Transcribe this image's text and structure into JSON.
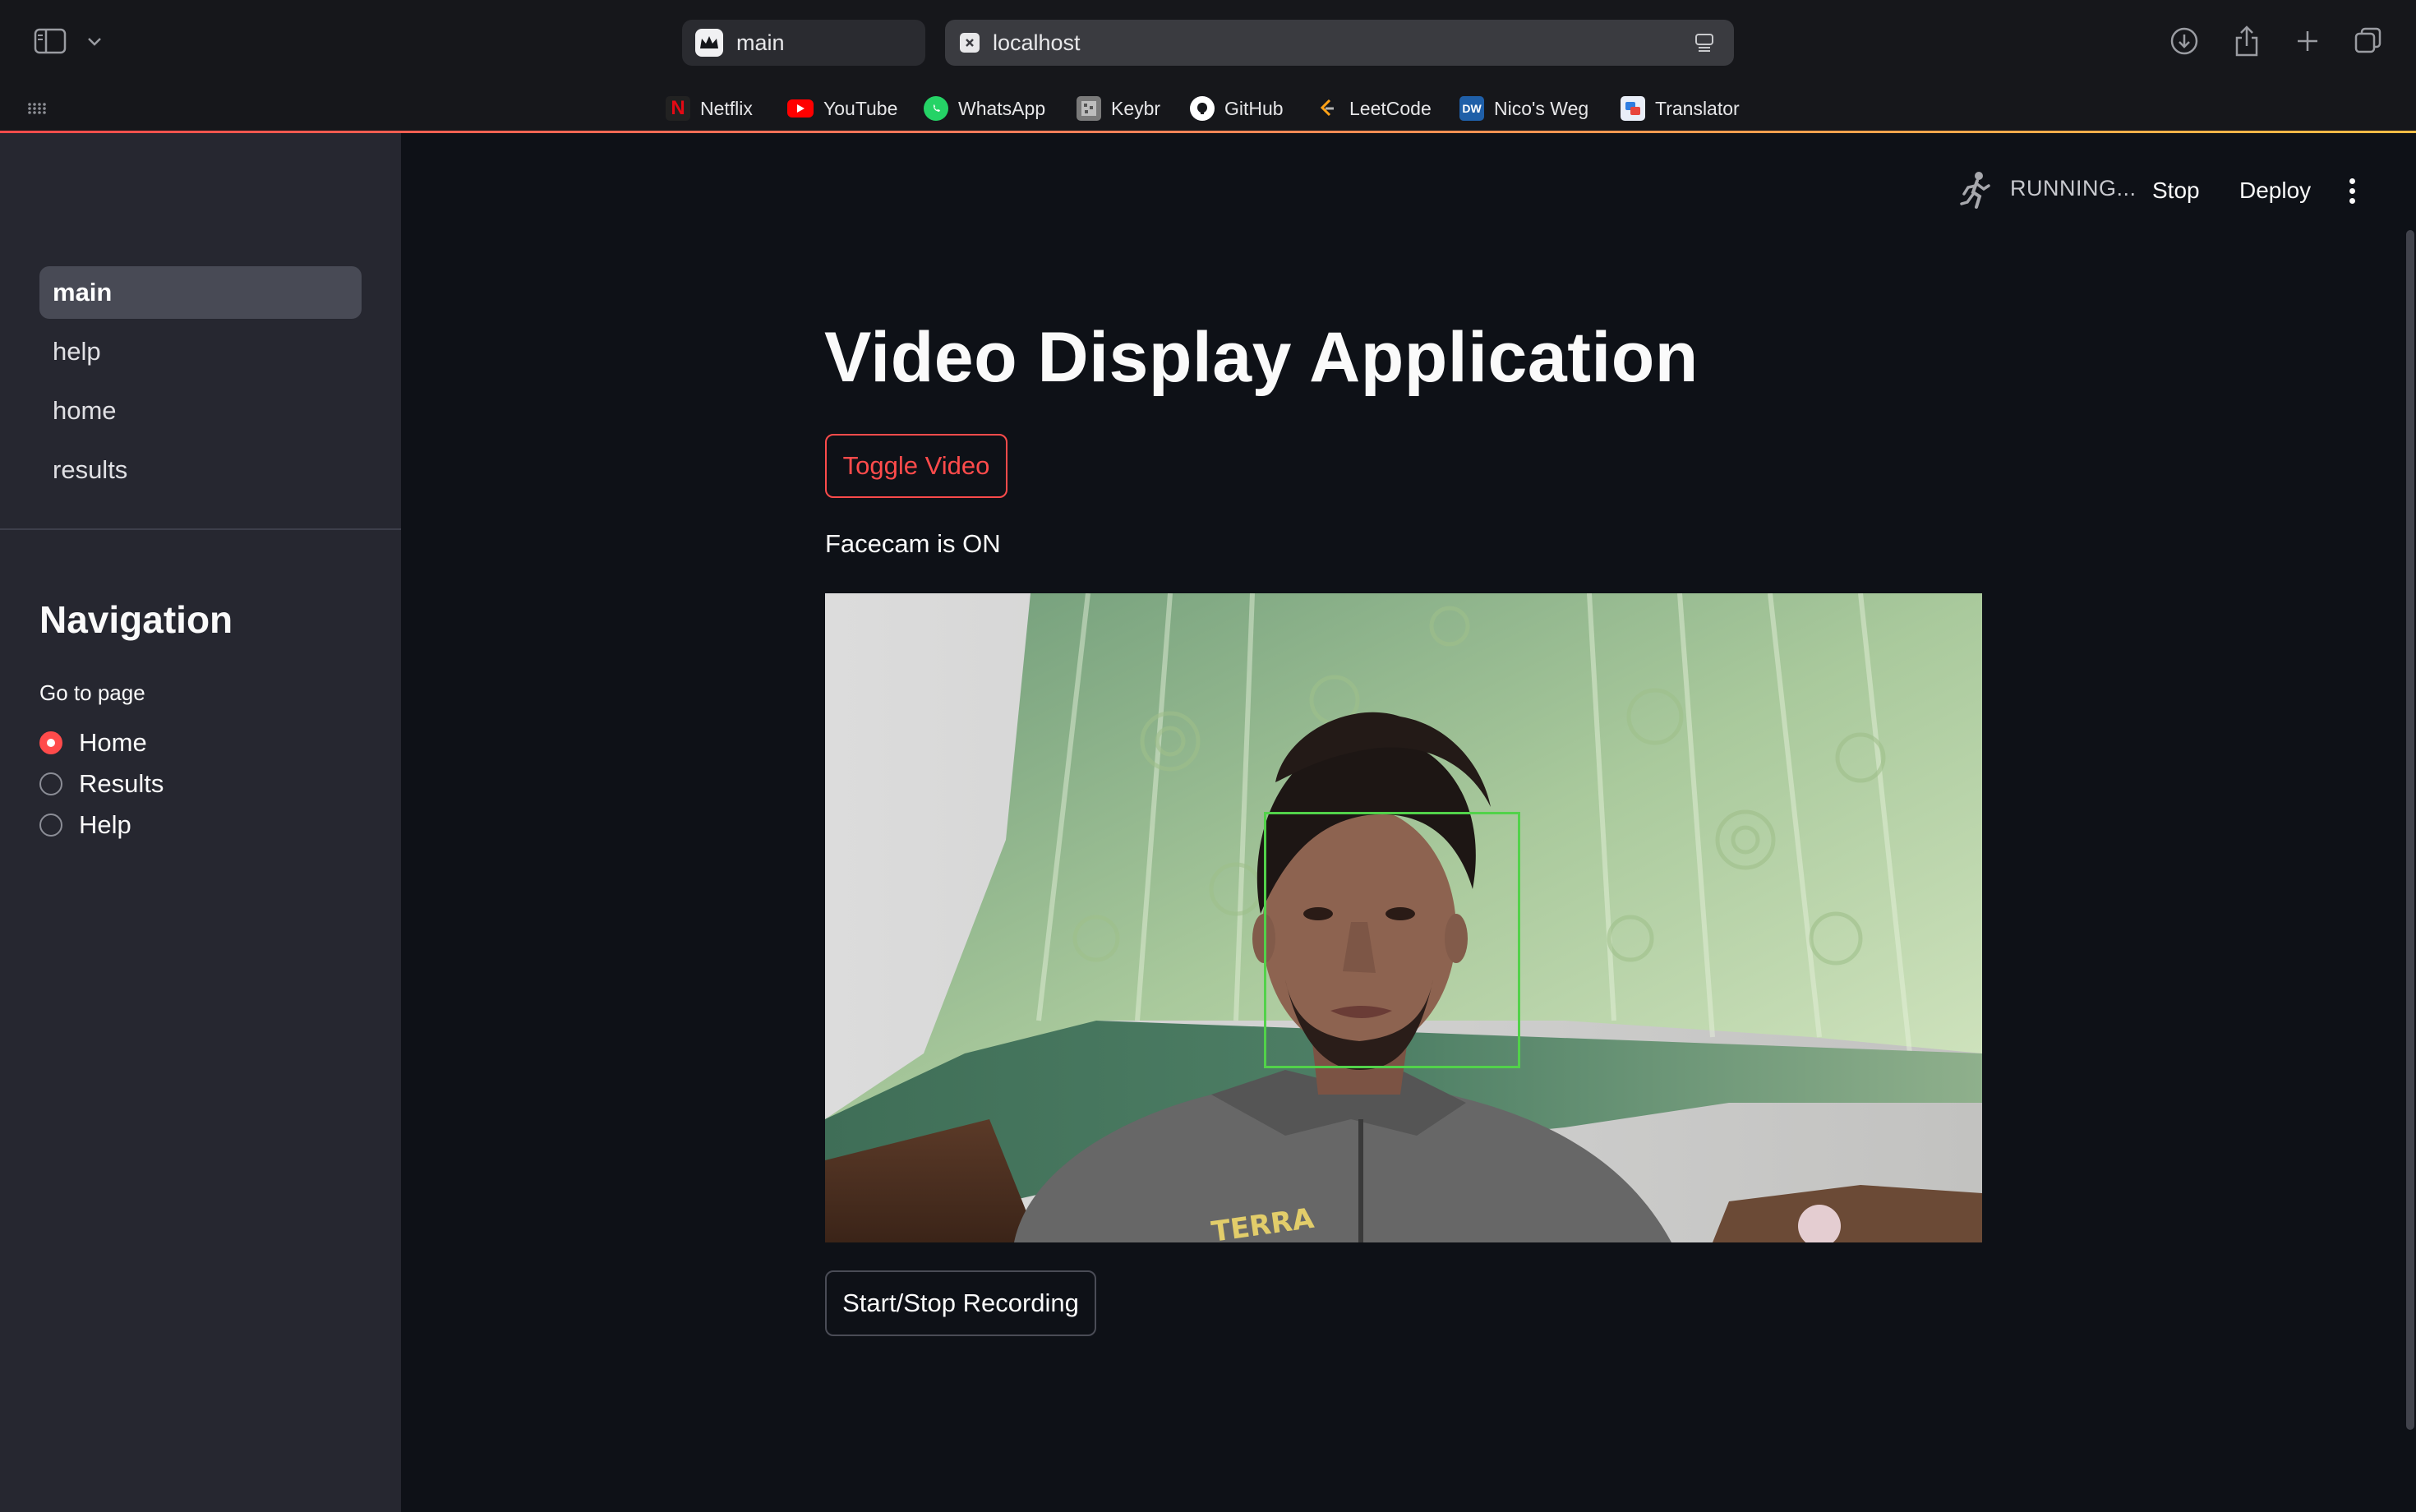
{
  "browser": {
    "tabs": [
      {
        "label": "main",
        "icon": "streamlit-crown-icon"
      },
      {
        "label": "localhost",
        "icon": "close-icon"
      }
    ],
    "bookmarks": [
      {
        "label": "Netflix",
        "icon": "netflix-icon",
        "color": "#e50914"
      },
      {
        "label": "YouTube",
        "icon": "youtube-icon",
        "color": "#ff0000"
      },
      {
        "label": "WhatsApp",
        "icon": "whatsapp-icon",
        "color": "#25d366"
      },
      {
        "label": "Keybr",
        "icon": "keybr-icon",
        "color": "#9a9a9a"
      },
      {
        "label": "GitHub",
        "icon": "github-icon",
        "color": "#ffffff"
      },
      {
        "label": "LeetCode",
        "icon": "leetcode-icon",
        "color": "#ffa116"
      },
      {
        "label": "Nico's Weg",
        "icon": "nicos-weg-icon",
        "color": "#1f5fa8"
      },
      {
        "label": "Translator",
        "icon": "translator-icon",
        "color": "#2f7de1"
      }
    ]
  },
  "sidebar": {
    "pages": [
      {
        "label": "main",
        "active": true
      },
      {
        "label": "help",
        "active": false
      },
      {
        "label": "home",
        "active": false
      },
      {
        "label": "results",
        "active": false
      }
    ],
    "nav_title": "Navigation",
    "radio_label": "Go to page",
    "radio_options": [
      {
        "label": "Home",
        "selected": true
      },
      {
        "label": "Results",
        "selected": false
      },
      {
        "label": "Help",
        "selected": false
      }
    ]
  },
  "header": {
    "status": "RUNNING...",
    "stop_label": "Stop",
    "deploy_label": "Deploy"
  },
  "main": {
    "title": "Video Display Application",
    "toggle_label": "Toggle Video",
    "facecam_status": "Facecam is ON",
    "record_label": "Start/Stop Recording",
    "video_caption": "TERRA"
  },
  "colors": {
    "accent": "#ff4b4b",
    "background": "#0e1117",
    "sidebar": "#262730",
    "face_box": "#52d24a"
  }
}
